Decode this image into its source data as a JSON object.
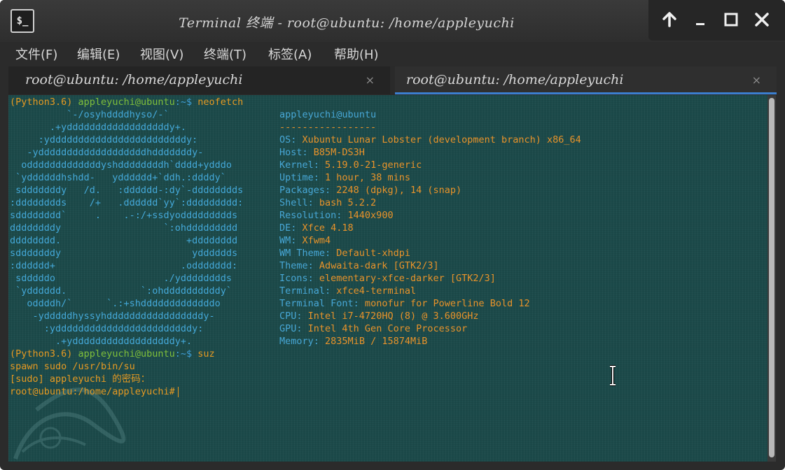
{
  "window": {
    "title": "Terminal 终端 - root@ubuntu: /home/appleyuchi",
    "app_icon": "$_",
    "controls": [
      "up-arrow-icon",
      "minimize-icon",
      "maximize-icon",
      "close-icon"
    ]
  },
  "menubar": {
    "items": [
      "文件(F)",
      "编辑(E)",
      "视图(V)",
      "终端(T)",
      "标签(A)",
      "帮助(H)"
    ]
  },
  "tabs": [
    {
      "label": "root@ubuntu: /home/appleyuchi",
      "close": "×",
      "active": false
    },
    {
      "label": "root@ubuntu: /home/appleyuchi",
      "close": "×",
      "active": true
    }
  ],
  "terminal": {
    "prompt1": {
      "env": "(Python3.6)",
      "user": "appleyuchi@ubuntu",
      "path": ":~$",
      "cmd": " neofetch"
    },
    "art": [
      "          `-/osyhddddhyso/-`",
      "       .+yddddddddddddddddddy+.",
      "     :yddddddddddddddddddddddddy:",
      "   -ydddddddddddddddddddhdddddddy-",
      "  odddddddddddddyshddddddddh`dddd+ydddo",
      " `yddddddhshdd-   ydddddd+`ddh.:ddddy`",
      " sdddddddy   /d.   :dddddd-:dy`-dddddddds",
      ":dddddddds    /+   .dddddd`yy`:ddddddddd:",
      "sdddddddd`     .    .-:/+ssdyoddddddddds",
      "ddddddddy                  `:ohddddddddd",
      "dddddddd.                      +dddddddd",
      "sdddddddy                       ydddddds",
      ":dddddd+                      .oddddddd:",
      " sdddddo                   ./ydddddddds",
      " `ydddddd.             `:ohddddddddddy`",
      "   oddddh/`      `.:+shdddddddddddddo",
      "    -ydddddhyssyhdddddddddddddddddy-",
      "      :yddddddddddddddddddddddddy:",
      "        .+yddddddddddddddddddy+."
    ],
    "info_header": "appleyuchi@ubuntu",
    "info_sep": "-----------------",
    "info": [
      {
        "key": "OS",
        "value": "Xubuntu Lunar Lobster (development branch) x86_64"
      },
      {
        "key": "Host",
        "value": "B85M-DS3H"
      },
      {
        "key": "Kernel",
        "value": "5.19.0-21-generic"
      },
      {
        "key": "Uptime",
        "value": "1 hour, 38 mins"
      },
      {
        "key": "Packages",
        "value": "2248 (dpkg), 14 (snap)"
      },
      {
        "key": "Shell",
        "value": "bash 5.2.2"
      },
      {
        "key": "Resolution",
        "value": "1440x900"
      },
      {
        "key": "DE",
        "value": "Xfce 4.18"
      },
      {
        "key": "WM",
        "value": "Xfwm4"
      },
      {
        "key": "WM Theme",
        "value": "Default-xhdpi"
      },
      {
        "key": "Theme",
        "value": "Adwaita-dark [GTK2/3]"
      },
      {
        "key": "Icons",
        "value": "elementary-xfce-darker [GTK2/3]"
      },
      {
        "key": "Terminal",
        "value": "xfce4-terminal"
      },
      {
        "key": "Terminal Font",
        "value": "monofur for Powerline Bold 12"
      },
      {
        "key": "CPU",
        "value": "Intel i7-4720HQ (8) @ 3.600GHz"
      },
      {
        "key": "GPU",
        "value": "Intel 4th Gen Core Processor"
      },
      {
        "key": "Memory",
        "value": "2835MiB / 15874MiB"
      }
    ],
    "prompt2": {
      "env": "(Python3.6)",
      "user": "appleyuchi@ubuntu",
      "path": ":~$",
      "cmd": " suz"
    },
    "out1": "spawn sudo /usr/bin/su",
    "out2": "[sudo] appleyuchi 的密码：",
    "root_prompt": "root@ubuntu:/home/appleyuchi#"
  },
  "colors": {
    "terminal_bg": "#1c4a4a",
    "orange": "#e69a22",
    "green": "#7fbf3a",
    "blue": "#3f9fd8",
    "tab_accent": "#3b7fd0"
  }
}
